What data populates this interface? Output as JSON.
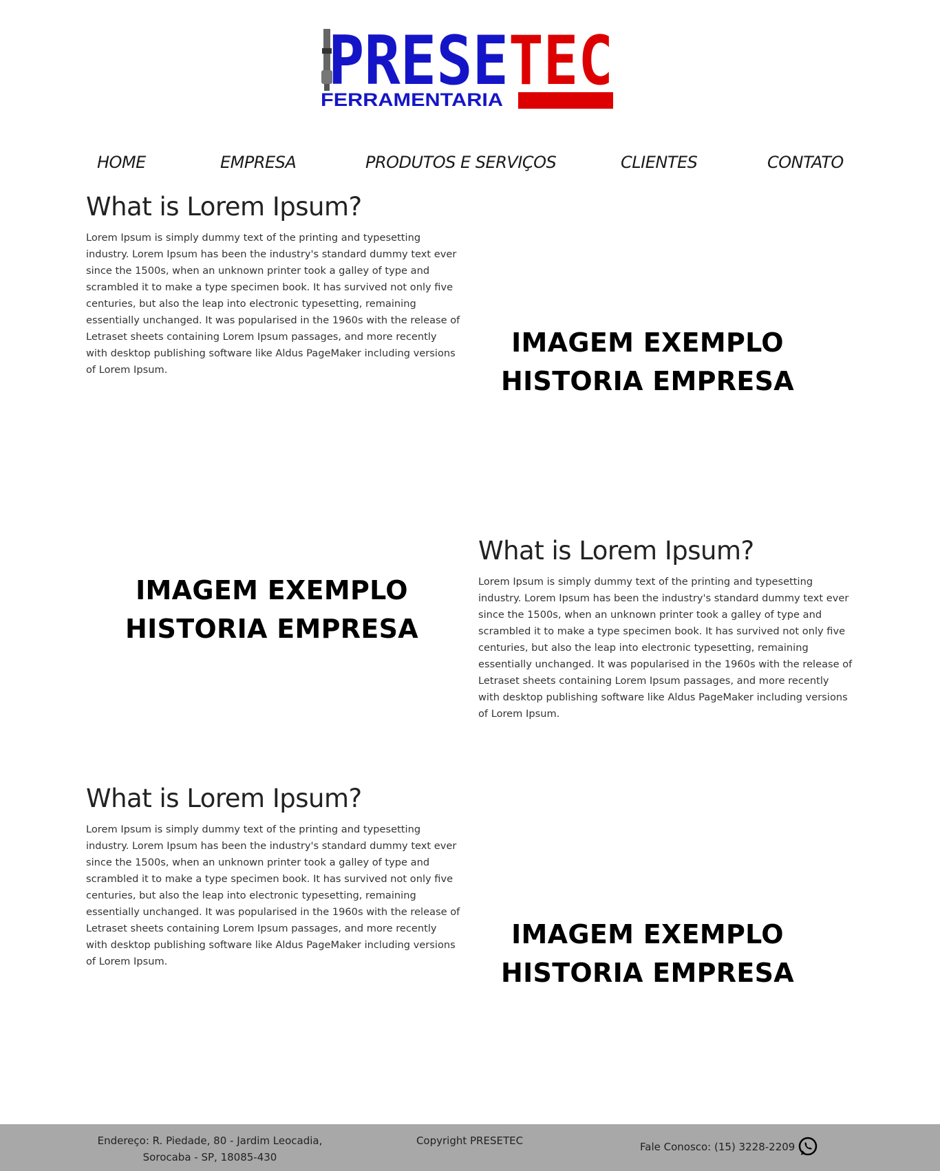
{
  "logo": {
    "brand_left": "PRESE",
    "brand_right": "TEC",
    "tagline": "FERRAMENTARIA",
    "colors": {
      "blue": "#1515c8",
      "red": "#dd0000"
    }
  },
  "nav": [
    "HOME",
    "EMPRESA",
    "PRODUTOS E SERVIÇOS",
    "CLIENTES",
    "CONTATO"
  ],
  "sections": [
    {
      "heading": "What is Lorem Ipsum?",
      "paragraph": "Lorem Ipsum is simply dummy text of the printing and typesetting industry. Lorem Ipsum has been the industry's standard dummy text ever since the 1500s, when an unknown printer took a galley of type and scrambled it to make a type specimen book. It has survived not only five centuries, but also the leap into electronic typesetting, remaining essentially unchanged. It was popularised in the 1960s with the release of Letraset sheets containing Lorem Ipsum passages, and more recently with desktop publishing software like Aldus PageMaker including versions of Lorem Ipsum.",
      "image_line1": "IMAGEM EXEMPLO",
      "image_line2": "HISTORIA EMPRESA"
    },
    {
      "heading": "What is Lorem Ipsum?",
      "paragraph": "Lorem Ipsum is simply dummy text of the printing and typesetting industry. Lorem Ipsum has been the industry's standard dummy text ever since the 1500s, when an unknown printer took a galley of type and scrambled it to make a type specimen book. It has survived not only five centuries, but also the leap into electronic typesetting, remaining essentially unchanged. It was popularised in the 1960s with the release of Letraset sheets containing Lorem Ipsum passages, and more recently with desktop publishing software like Aldus PageMaker including versions of Lorem Ipsum.",
      "image_line1": "IMAGEM EXEMPLO",
      "image_line2": "HISTORIA EMPRESA"
    },
    {
      "heading": "What is Lorem Ipsum?",
      "paragraph": "Lorem Ipsum is simply dummy text of the printing and typesetting industry. Lorem Ipsum has been the industry's standard dummy text ever since the 1500s, when an unknown printer took a galley of type and scrambled it to make a type specimen book. It has survived not only five centuries, but also the leap into electronic typesetting, remaining essentially unchanged. It was popularised in the 1960s with the release of Letraset sheets containing Lorem Ipsum passages, and more recently with desktop publishing software like Aldus PageMaker including versions of Lorem Ipsum.",
      "image_line1": "IMAGEM EXEMPLO",
      "image_line2": "HISTORIA EMPRESA"
    }
  ],
  "footer": {
    "address_line1": "Endereço: R. Piedade, 80 - Jardim Leocadia,",
    "address_line2": "Sorocaba - SP, 18085-430",
    "copyright": "Copyright PRESETEC",
    "phone": "Fale Conosco: (15) 3228-2209",
    "phone_icon": "whatsapp-icon",
    "background": "#a8a8a8"
  }
}
